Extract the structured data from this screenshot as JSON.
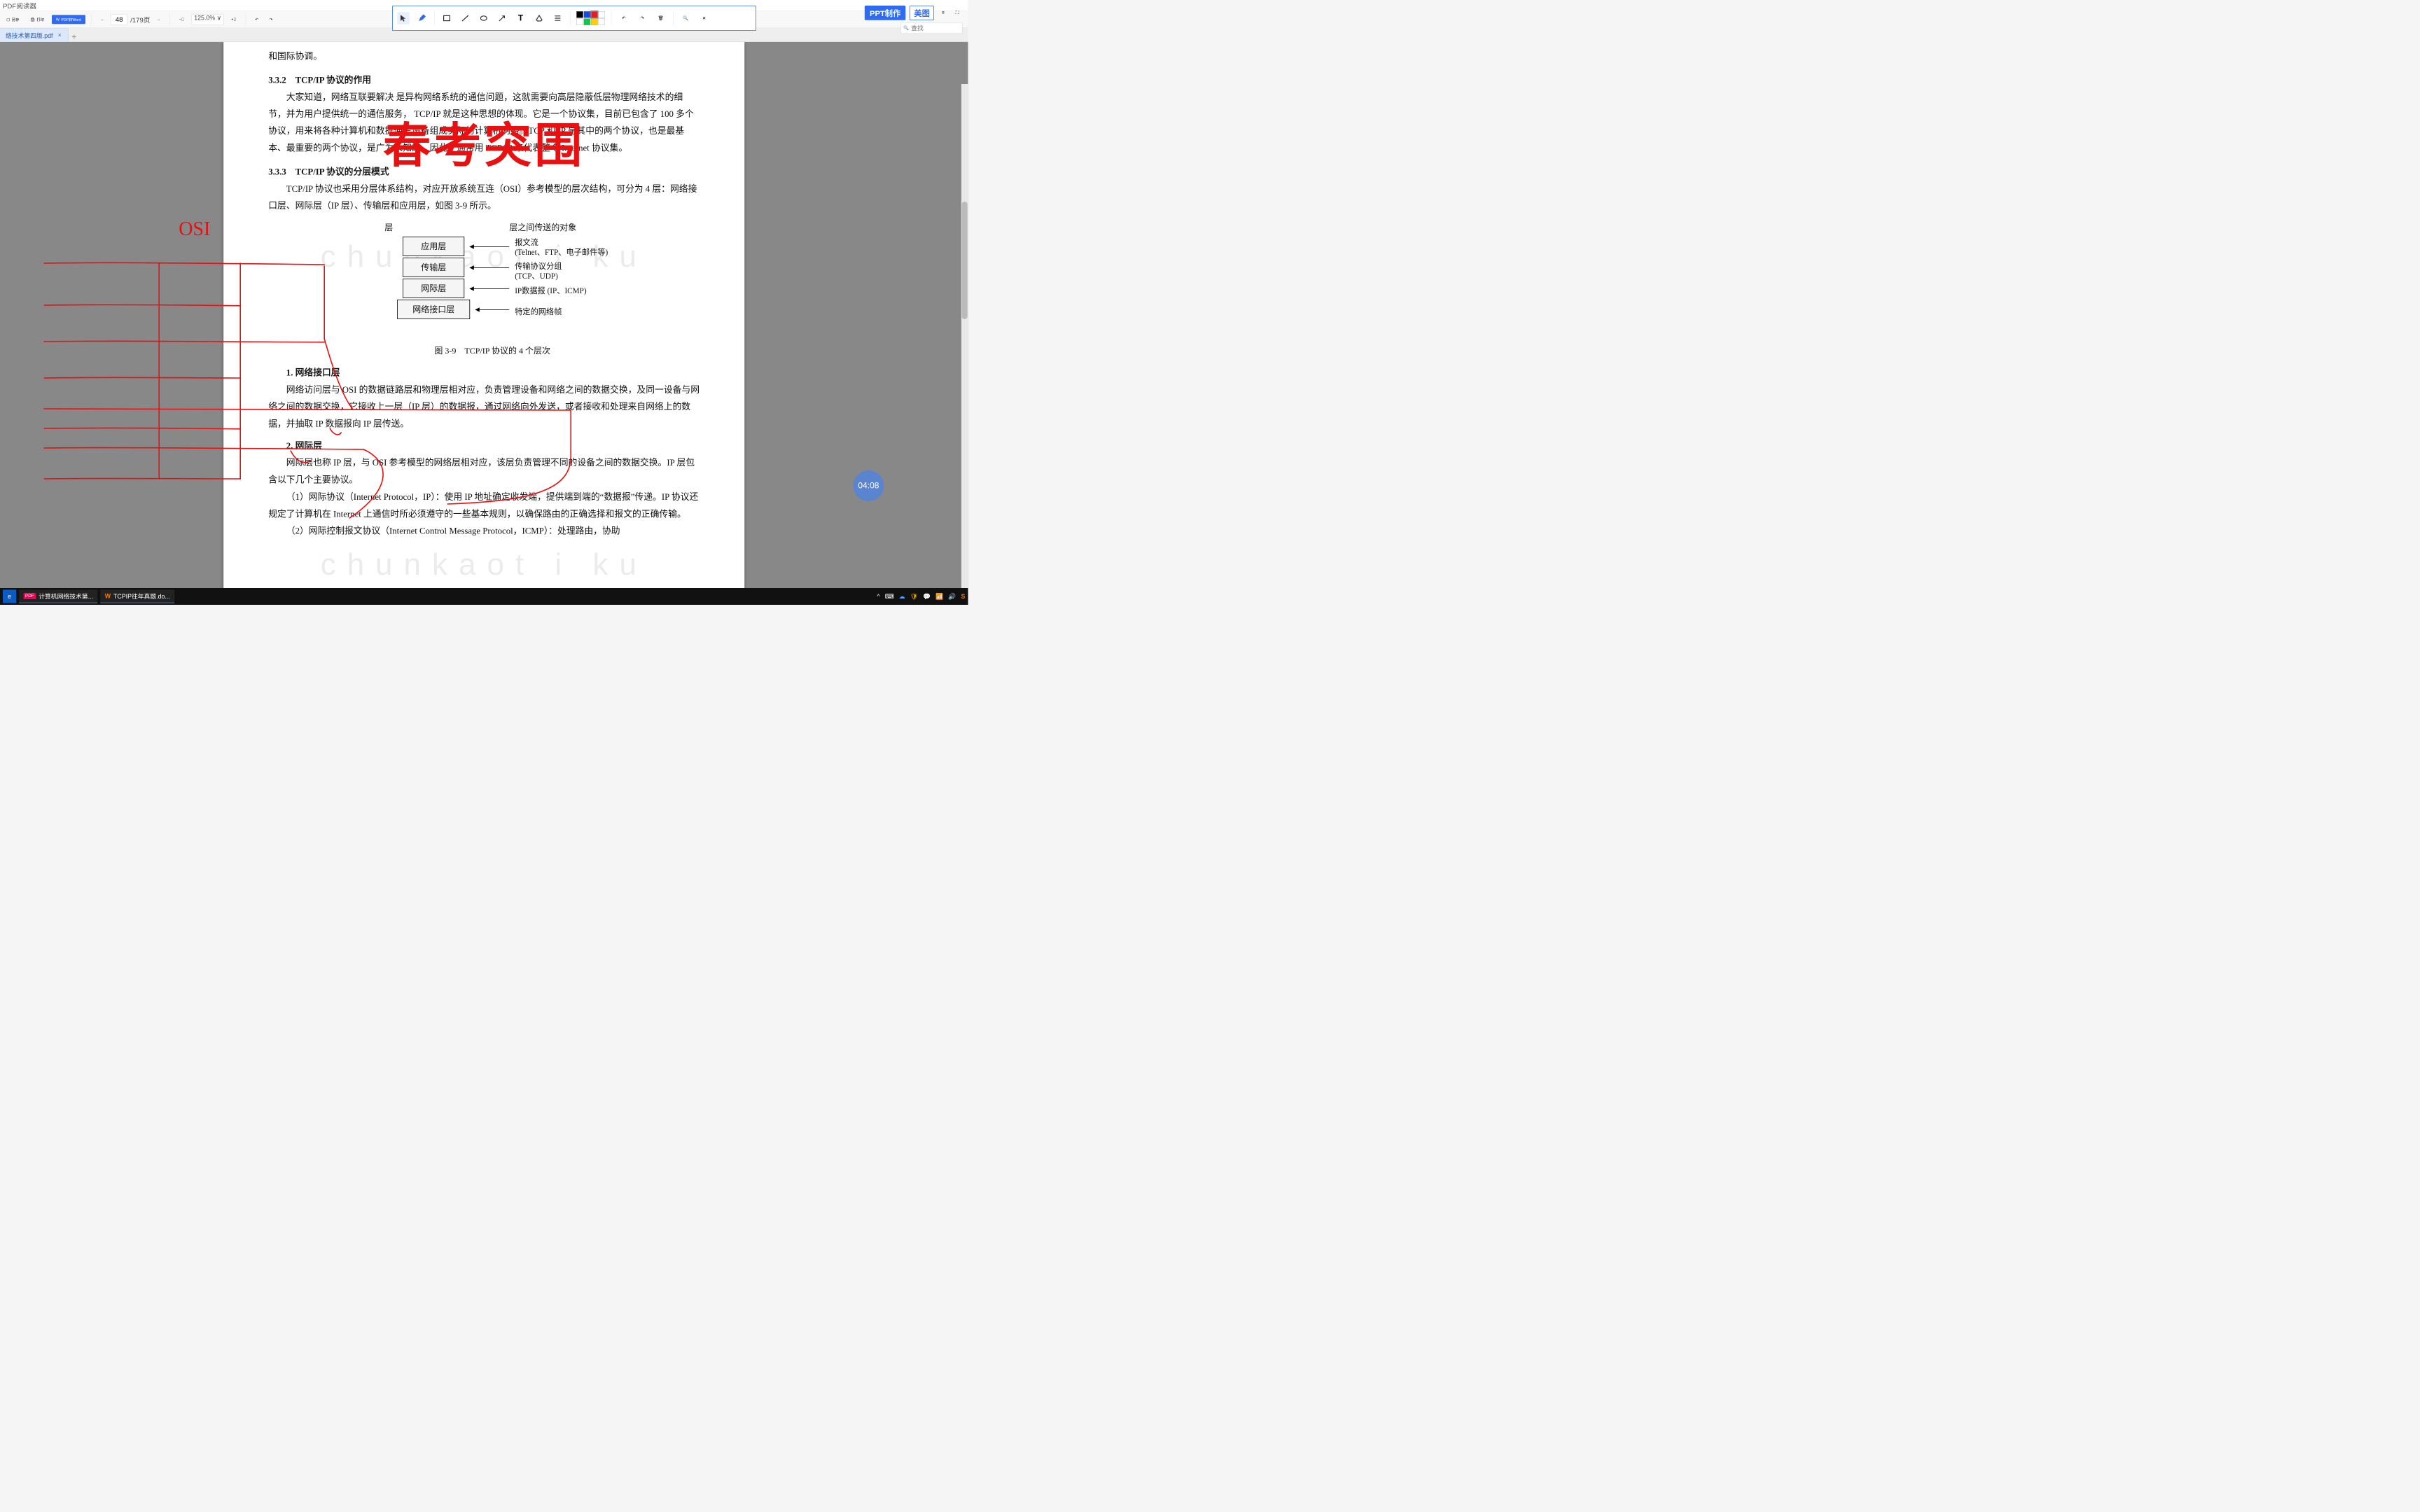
{
  "app": {
    "title": "PDF阅读器"
  },
  "toolbar": {
    "save_as": "另存",
    "print": "打印",
    "pdf_to_word": "PDF转Word",
    "page_current": "48",
    "page_total": "/179页",
    "zoom": "125.0% ∨"
  },
  "annotation_colors": {
    "r0c0": "#000000",
    "r0c1": "#1a4bd8",
    "r0c2": "#e02020",
    "r0c3": "#ffffff",
    "r1c0": "#ffffff",
    "r1c1": "#19c24a",
    "r1c2": "#ffd000",
    "r1c3": "#ffffff"
  },
  "right": {
    "ppt": "PPT制作",
    "meitu": "美图",
    "search_placeholder": "查找"
  },
  "tab": {
    "name": "络技术第四版.pdf"
  },
  "overlay": {
    "big": "春考突围",
    "timer": "04:08"
  },
  "watermarks": {
    "w1": "chunkaot i ku",
    "w2": "chunkaot i ku"
  },
  "doc": {
    "p0": "和国际协调。",
    "h332": "3.3.2　TCP/IP 协议的作用",
    "p1": "大家知道，网络互联要解决 是异构网络系统的通信问题，这就需要向高层隐蔽低层物理网络技术的细节，并为用户提供统一的通信服务， TCP/IP 就是这种思想的体现。它是一个协议集，目前已包含了 100 多个协议，用来将各种计算机和数据通信设备组成实际的计算机网络。TCP 和 IP 是其中的两个协议，也是最基本、最重要的两个协议，是广为人知的，因此，通常用 TCP/IP 来代表整个 Internet 协议集。",
    "h333": "3.3.3　TCP/IP 协议的分层模式",
    "p2": "TCP/IP 协议也采用分层体系结构，对应开放系统互连（OSI）参考模型的层次结构，可分为 4 层：网络接口层、网际层（IP 层）、传输层和应用层，如图 3-9 所示。",
    "diag": {
      "col1": "层",
      "col2": "层之间传送的对象",
      "l1": "应用层",
      "l2": "传输层",
      "l3": "网际层",
      "l4": "网络接口层",
      "r1a": "报文流",
      "r1b": "(Telnet、FTP、电子邮件等)",
      "r2a": "传输协议分组",
      "r2b": "(TCP、UDP)",
      "r3": "IP数据报 (IP、ICMP)",
      "r4": "特定的网络帧",
      "caption": "图 3-9　TCP/IP 协议的 4 个层次"
    },
    "h41": "1. 网络接口层",
    "p3": "网络访问层与 OSI 的数据链路层和物理层相对应，负责管理设备和网络之间的数据交换，及同一设备与网络之间的数据交换，它接收上一层（IP 层）的数据报，通过网络向外发送，或者接收和处理来自网络上的数据，并抽取 IP 数据报向 IP 层传送。",
    "h42": "2. 网际层",
    "p4": "网际层也称 IP 层，与 OSI 参考模型的网络层相对应，该层负责管理不同的设备之间的数据交换。IP 层包含以下几个主要协议。",
    "p5": "（1）网际协议（Internet Protocol，IP）：使用 IP 地址确定收发端，提供端到端的“数据报”传递。IP 协议还规定了计算机在 Internet 上通信时所必须遵守的一些基本规则，以确保路由的正确选择和报文的正确传输。",
    "p6": "（2）网际控制报文协议（Internet Control Message Protocol，ICMP）：处理路由，协助"
  },
  "annotation_label": "OSI",
  "taskbar": {
    "t1": "计算机网络技术第...",
    "t2": "TCPIP往年真题.do...",
    "time": "",
    "tray_icons": [
      "^",
      "⌨",
      "☁",
      "🔒",
      "📶",
      "🔊",
      "S"
    ]
  }
}
